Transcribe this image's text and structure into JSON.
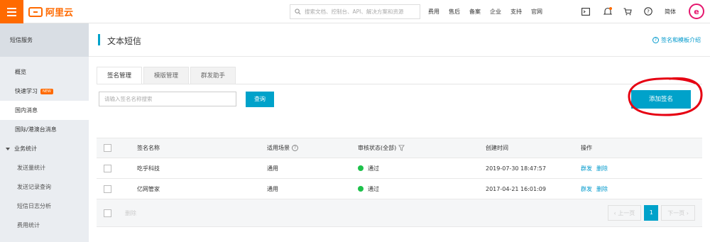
{
  "header": {
    "logo_text": "阿里云",
    "search_placeholder": "搜索文档、控制台、API、解决方案和资源",
    "nav": [
      "费用",
      "售后",
      "备案",
      "企业",
      "支持",
      "官网"
    ],
    "language": "简体",
    "avatar_letter": "e",
    "brand_color": "#ff6a00"
  },
  "sidebar": {
    "title": "短信服务",
    "items": [
      {
        "label": "概览"
      },
      {
        "label": "快速学习",
        "badge": "NEW"
      },
      {
        "label": "国内消息"
      },
      {
        "label": "国际/港澳台消息"
      },
      {
        "label": "业务统计"
      },
      {
        "label": "发送量统计"
      },
      {
        "label": "发送记录查询"
      },
      {
        "label": "短信日志分析"
      },
      {
        "label": "费用统计"
      }
    ]
  },
  "page": {
    "title": "文本短信",
    "help_link": "签名和模板介绍",
    "tabs": [
      "签名管理",
      "模版管理",
      "群发助手"
    ],
    "search_placeholder": "请输入签名名称搜索",
    "query_button": "查询",
    "add_button": "添加签名",
    "accent_color": "#00a2ca"
  },
  "table": {
    "columns": [
      "签名名称",
      "适用场景",
      "审核状态(全部)",
      "创建时间",
      "操作"
    ],
    "rows": [
      {
        "name": "吃乎科技",
        "scene": "通用",
        "status": "通过",
        "created": "2019-07-30 18:47:57",
        "ops": [
          "群发",
          "删除"
        ]
      },
      {
        "name": "亿网管家",
        "scene": "通用",
        "status": "通过",
        "created": "2017-04-21 16:01:09",
        "ops": [
          "群发",
          "删除"
        ]
      }
    ],
    "footer_delete": "删除",
    "pager": {
      "prev": "上一页",
      "current": "1",
      "next": "下一页"
    }
  }
}
